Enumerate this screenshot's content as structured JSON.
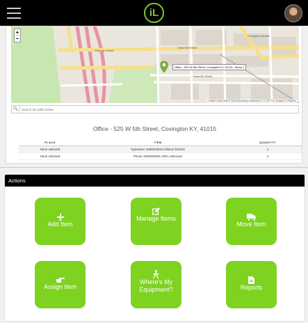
{
  "header": {
    "logo_text": "iL",
    "menu_icon": "hamburger-icon",
    "avatar_icon": "user-avatar"
  },
  "map": {
    "zoom_in": "+",
    "zoom_out": "−",
    "popup": "Office - 525 W 5th Street, Covington KY, 41015 - Items 2",
    "street_labels": [
      "West 5th Street",
      "West 6th Street",
      "Covington Avenue",
      "West 4th Street"
    ],
    "attribution_prefix": "Leaflet | Map data © ",
    "attribution_osm": "OpenStreetMap",
    "attribution_mid": " contributors, ",
    "attribution_cc": "CC-BY-SA",
    "attribution_imagery": ", Imagery © ",
    "attribution_mapbox": "Mapbox"
  },
  "search": {
    "icon": "search-icon",
    "placeholder": "Search the table below"
  },
  "place_title": "Office - 525 W 5th Street, Covington KY, 41015",
  "table": {
    "headers": [
      "PLACE",
      "ITEM",
      "QUANTITY"
    ],
    "rows": [
      [
        "None selected",
        "Typewriter 1556918043 Gibson Electric",
        "1"
      ],
      [
        "None selected",
        "Phone 1560000681 ARIA Unknown",
        "1"
      ]
    ]
  },
  "actions": {
    "title": "Actions",
    "tiles": [
      {
        "label": "Add Item",
        "icon": "plus-icon"
      },
      {
        "label": "Manage Items",
        "icon": "edit-icon"
      },
      {
        "label": "Move Item",
        "icon": "truck-icon"
      },
      {
        "label": "Assign Item",
        "icon": "hand-point-icon"
      },
      {
        "label": "Where's My Equipment?",
        "icon": "walking-person-icon"
      },
      {
        "label": "Reports",
        "icon": "document-icon"
      }
    ]
  },
  "colors": {
    "accent_green": "#7ed321",
    "header_black": "#000000",
    "logo_green": "#7ec636",
    "map_marker": "#7cb342"
  }
}
